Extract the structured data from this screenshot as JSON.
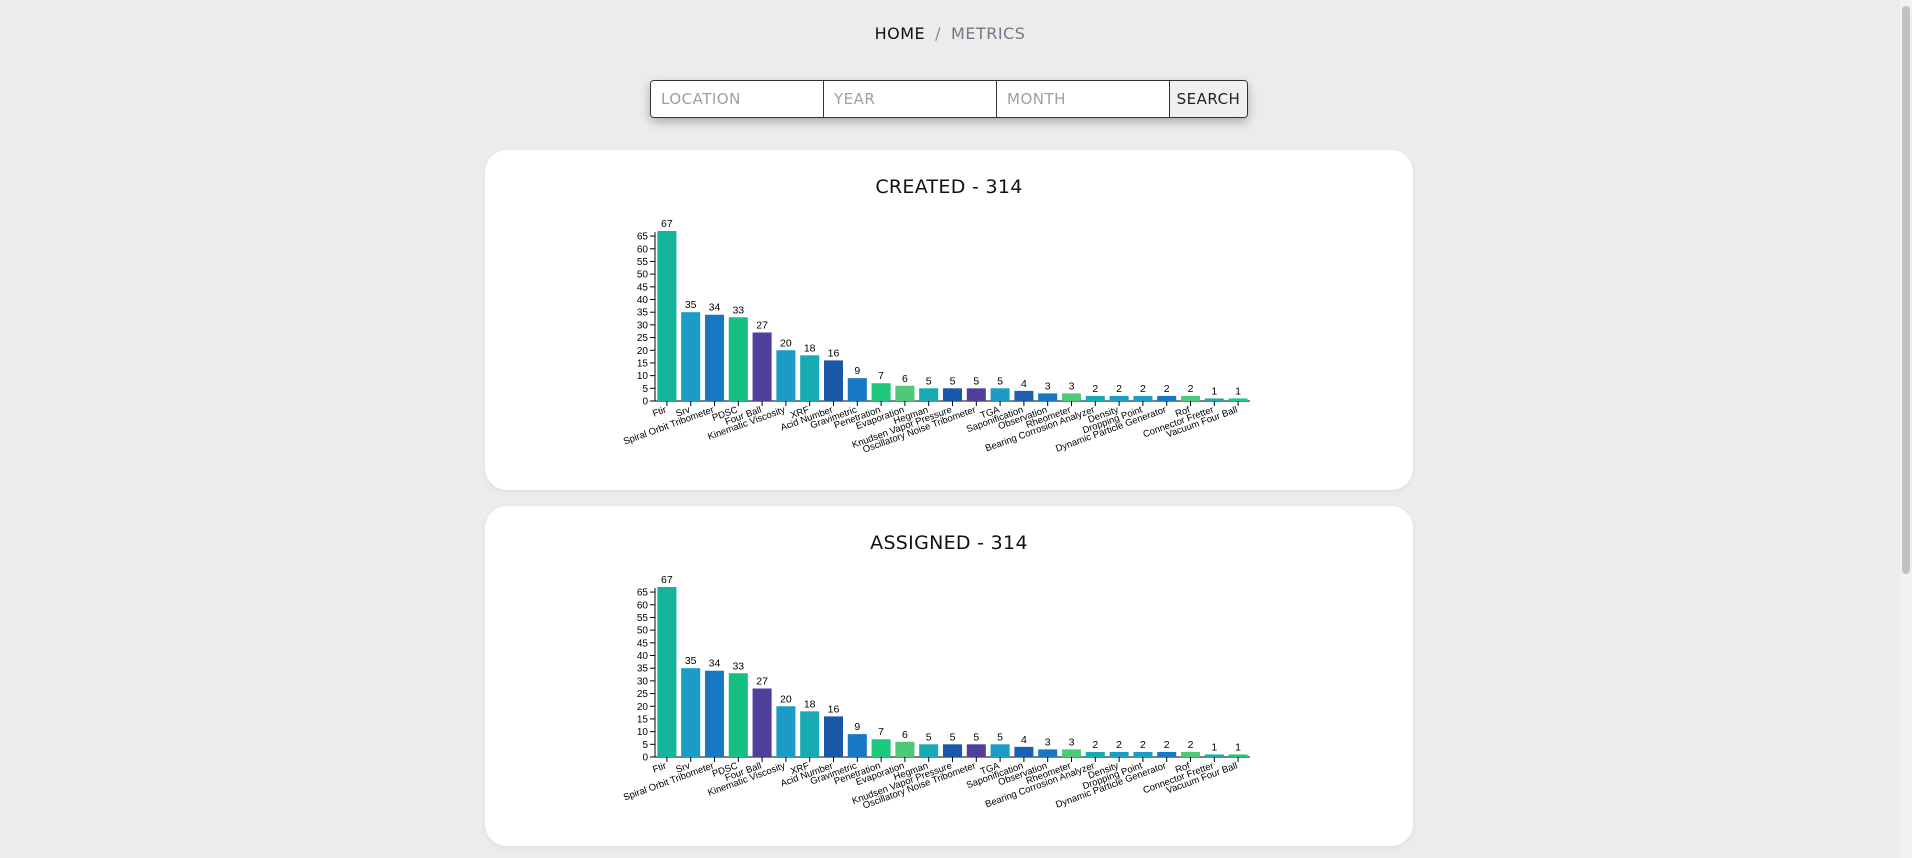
{
  "breadcrumb": {
    "home": "HOME",
    "separator": "/",
    "current": "METRICS"
  },
  "search": {
    "location_placeholder": "LOCATION",
    "year_placeholder": "YEAR",
    "month_placeholder": "MONTH",
    "button_label": "SEARCH"
  },
  "cards": [
    {
      "title": "CREATED - 314"
    },
    {
      "title": "ASSIGNED - 314"
    }
  ],
  "chart_data": [
    {
      "type": "bar",
      "title": "CREATED - 314",
      "categories": [
        "Ftir",
        "Srv",
        "Spiral Orbit Tribometer",
        "PDSC",
        "Four Ball",
        "Kinematic Viscosity",
        "XRF",
        "Acid Number",
        "Gravimetric",
        "Penetration",
        "Evaporation",
        "Hegman",
        "Knudsen Vapor Pressure",
        "Oscillatory Noise Tribometer",
        "TGA",
        "Saponification",
        "Observation",
        "Rheometer",
        "Bearing Corrosion Analyzer",
        "Density",
        "Dropping Point",
        "Dynamic Particle Generator",
        "Rof",
        "Connector Fretter",
        "Vacuum Four Ball"
      ],
      "values": [
        67,
        35,
        34,
        33,
        27,
        20,
        18,
        16,
        9,
        7,
        6,
        5,
        5,
        5,
        5,
        4,
        3,
        3,
        2,
        2,
        2,
        2,
        2,
        1,
        1
      ],
      "colors": [
        "#15b49c",
        "#1a9cc4",
        "#1677c4",
        "#14bf82",
        "#50409a",
        "#1a9cc4",
        "#17aab3",
        "#1a57a8",
        "#1677c4",
        "#1dc77c",
        "#4ec97a",
        "#17aab3",
        "#1a57a8",
        "#50409a",
        "#1a9cc4",
        "#1a62b0",
        "#1677c4",
        "#4ec97a",
        "#17aab3",
        "#1a9cc4",
        "#1a9cc4",
        "#1677c4",
        "#4ec97a",
        "#17aab3",
        "#1dc77c"
      ],
      "yticks": [
        0,
        5,
        10,
        15,
        20,
        25,
        30,
        35,
        40,
        45,
        50,
        55,
        60,
        65
      ],
      "ylim": [
        0,
        67
      ],
      "grid": false
    },
    {
      "type": "bar",
      "title": "ASSIGNED - 314",
      "categories": [
        "Ftir",
        "Srv",
        "Spiral Orbit Tribometer",
        "PDSC",
        "Four Ball",
        "Kinematic Viscosity",
        "XRF",
        "Acid Number",
        "Gravimetric",
        "Penetration",
        "Evaporation",
        "Hegman",
        "Knudsen Vapor Pressure",
        "Oscillatory Noise Tribometer",
        "TGA",
        "Saponification",
        "Observation",
        "Rheometer",
        "Bearing Corrosion Analyzer",
        "Density",
        "Dropping Point",
        "Dynamic Particle Generator",
        "Rof",
        "Connector Fretter",
        "Vacuum Four Ball"
      ],
      "values": [
        67,
        35,
        34,
        33,
        27,
        20,
        18,
        16,
        9,
        7,
        6,
        5,
        5,
        5,
        5,
        4,
        3,
        3,
        2,
        2,
        2,
        2,
        2,
        1,
        1
      ],
      "colors": [
        "#15b49c",
        "#1a9cc4",
        "#1677c4",
        "#14bf82",
        "#50409a",
        "#1a9cc4",
        "#17aab3",
        "#1a57a8",
        "#1677c4",
        "#1dc77c",
        "#4ec97a",
        "#17aab3",
        "#1a57a8",
        "#50409a",
        "#1a9cc4",
        "#1a62b0",
        "#1677c4",
        "#4ec97a",
        "#17aab3",
        "#1a9cc4",
        "#1a9cc4",
        "#1677c4",
        "#4ec97a",
        "#17aab3",
        "#1dc77c"
      ],
      "yticks": [
        0,
        5,
        10,
        15,
        20,
        25,
        30,
        35,
        40,
        45,
        50,
        55,
        60,
        65
      ],
      "ylim": [
        0,
        67
      ],
      "grid": false
    }
  ]
}
